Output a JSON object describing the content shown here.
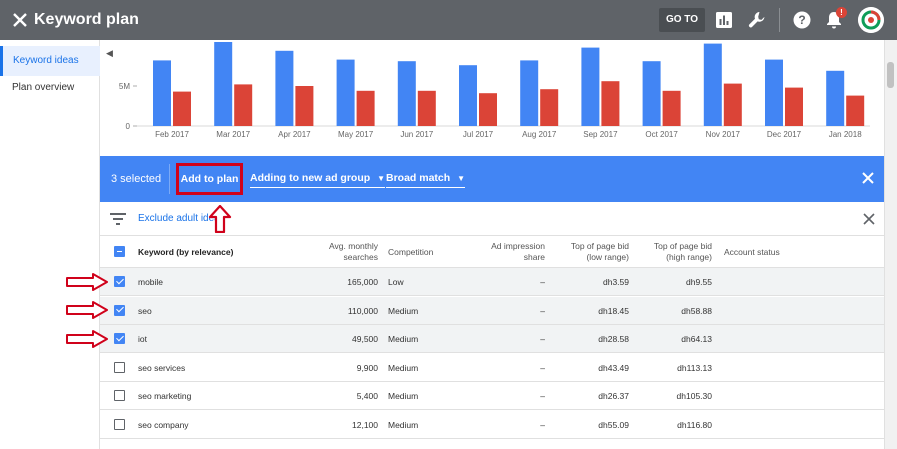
{
  "app": {
    "title": "Keyword plan",
    "goto_label": "GO TO",
    "notification_count": "!"
  },
  "sidebar": {
    "items": [
      {
        "label": "Keyword ideas",
        "active": true
      },
      {
        "label": "Plan overview",
        "active": false
      }
    ]
  },
  "chart_data": {
    "type": "bar",
    "categories": [
      "Feb 2017",
      "Mar 2017",
      "Apr 2017",
      "May 2017",
      "Jun 2017",
      "Jul 2017",
      "Aug 2017",
      "Sep 2017",
      "Oct 2017",
      "Nov 2017",
      "Dec 2017",
      "Jan 2018"
    ],
    "series": [
      {
        "color": "#4285f4",
        "values": [
          8.2,
          10.5,
          9.4,
          8.3,
          8.1,
          7.6,
          8.2,
          9.8,
          8.1,
          10.3,
          8.3,
          6.9
        ]
      },
      {
        "color": "#db4437",
        "values": [
          4.3,
          5.2,
          5.0,
          4.4,
          4.4,
          4.1,
          4.6,
          5.6,
          4.4,
          5.3,
          4.8,
          3.8
        ]
      }
    ],
    "yticks": [
      "5M",
      "0"
    ],
    "ylim": [
      0,
      10.5
    ]
  },
  "actionbar": {
    "selected_text": "3 selected",
    "add_to_plan": "Add to plan",
    "ad_group_dropdown": "Adding to new ad group",
    "match_dropdown": "Broad match"
  },
  "filter": {
    "link_text": "Exclude adult ideas"
  },
  "table": {
    "headers": {
      "keyword": "Keyword (by relevance)",
      "searches": "Avg. monthly searches",
      "competition": "Competition",
      "impression": "Ad impression share",
      "bid_low": "Top of page bid (low range)",
      "bid_high": "Top of page bid (high range)",
      "status": "Account status"
    },
    "rows": [
      {
        "keyword": "mobile",
        "searches": "165,000",
        "competition": "Low",
        "impression": "–",
        "bid_low": "dh3.59",
        "bid_high": "dh9.55",
        "checked": true
      },
      {
        "keyword": "seo",
        "searches": "110,000",
        "competition": "Medium",
        "impression": "–",
        "bid_low": "dh18.45",
        "bid_high": "dh58.88",
        "checked": true
      },
      {
        "keyword": "iot",
        "searches": "49,500",
        "competition": "Medium",
        "impression": "–",
        "bid_low": "dh28.58",
        "bid_high": "dh64.13",
        "checked": true
      },
      {
        "keyword": "seo services",
        "searches": "9,900",
        "competition": "Medium",
        "impression": "–",
        "bid_low": "dh43.49",
        "bid_high": "dh113.13",
        "checked": false
      },
      {
        "keyword": "seo marketing",
        "searches": "5,400",
        "competition": "Medium",
        "impression": "–",
        "bid_low": "dh26.37",
        "bid_high": "dh105.30",
        "checked": false
      },
      {
        "keyword": "seo company",
        "searches": "12,100",
        "competition": "Medium",
        "impression": "–",
        "bid_low": "dh55.09",
        "bid_high": "dh116.80",
        "checked": false
      }
    ]
  },
  "colors": {
    "topbar": "#5f6368",
    "accent": "#4285f4",
    "highlight": "#d0021b",
    "bar_blue": "#4285f4",
    "bar_red": "#db4437"
  }
}
